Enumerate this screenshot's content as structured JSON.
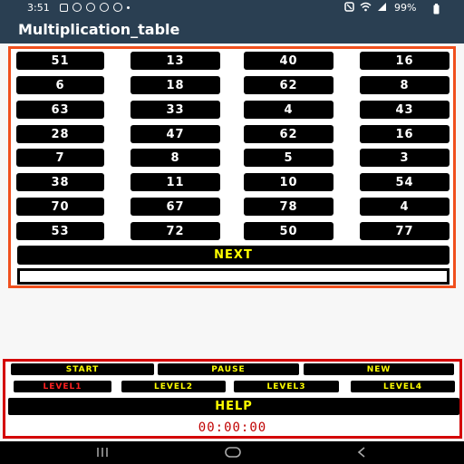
{
  "status_bar": {
    "time": "3:51",
    "battery": "99%",
    "left_icons": [
      "photos-icon",
      "sync-icon",
      "vpn-icon",
      "location-icon",
      "settings-icon",
      "more-dot-icon"
    ],
    "right_icons": [
      "alarm-icon",
      "wifi-icon",
      "signal-icon"
    ]
  },
  "app_bar": {
    "title": "Multiplication_table"
  },
  "grid": {
    "rows": [
      [
        "51",
        "13",
        "40",
        "16"
      ],
      [
        "6",
        "18",
        "62",
        "8"
      ],
      [
        "63",
        "33",
        "4",
        "43"
      ],
      [
        "28",
        "47",
        "62",
        "16"
      ],
      [
        "7",
        "8",
        "5",
        "3"
      ],
      [
        "38",
        "11",
        "10",
        "54"
      ],
      [
        "70",
        "67",
        "78",
        "4"
      ],
      [
        "53",
        "72",
        "50",
        "77"
      ]
    ],
    "next_label": "NEXT",
    "answer_value": ""
  },
  "controls": {
    "start_label": "START",
    "pause_label": "PAUSE",
    "new_label": "NEW",
    "level1_label": "LEVEL1",
    "level2_label": "LEVEL2",
    "level3_label": "LEVEL3",
    "level4_label": "LEVEL4",
    "help_label": "HELP",
    "timer": "00:00:00"
  },
  "colors": {
    "app_bar": "#2a3f52",
    "grid_border": "#f0501e",
    "control_border": "#d40000",
    "accent_text": "#ffff00",
    "active_level_text": "#ff2020",
    "timer_text": "#c00000"
  },
  "nav_bar": {
    "icons": [
      "recent-apps-icon",
      "home-icon",
      "back-icon"
    ]
  }
}
